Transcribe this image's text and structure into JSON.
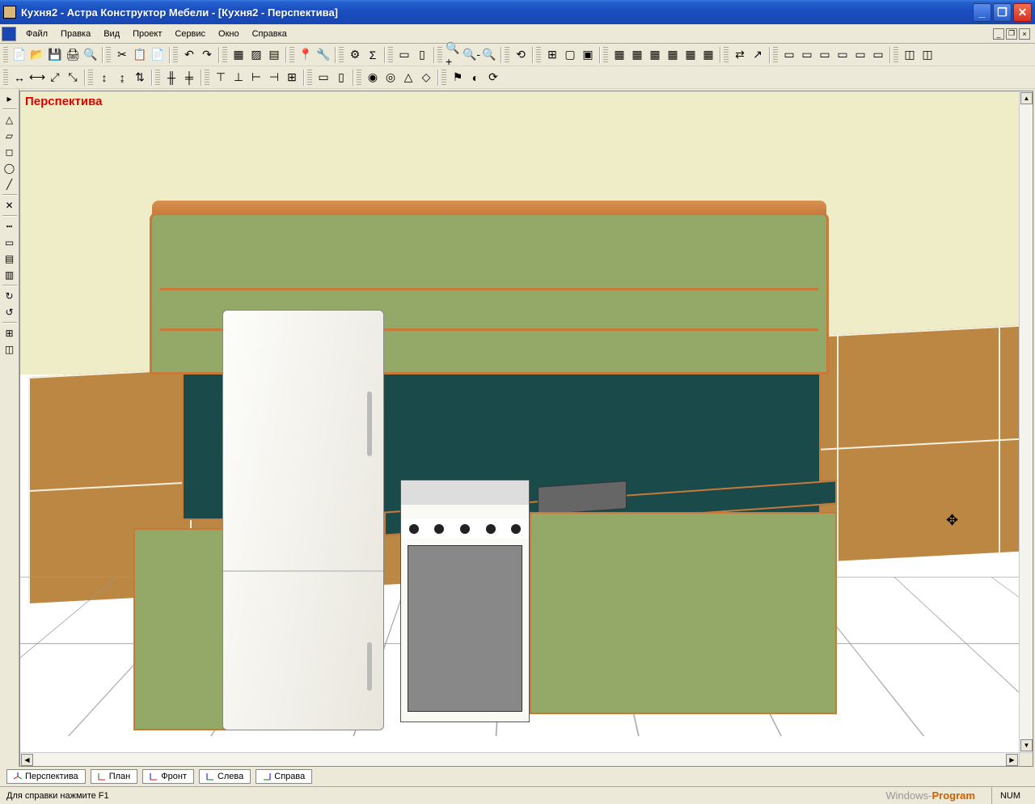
{
  "window": {
    "title": "Кухня2 - Астра Конструктор Мебели - [Кухня2 - Перспектива]"
  },
  "menu": {
    "items": [
      "Файл",
      "Правка",
      "Вид",
      "Проект",
      "Сервис",
      "Окно",
      "Справка"
    ]
  },
  "viewport": {
    "label": "Перспектива"
  },
  "viewTabs": [
    {
      "label": "Перспектива",
      "icon": "axes-3d",
      "active": true
    },
    {
      "label": "План",
      "icon": "axes-top"
    },
    {
      "label": "Фронт",
      "icon": "axes-front"
    },
    {
      "label": "Слева",
      "icon": "axes-left"
    },
    {
      "label": "Справа",
      "icon": "axes-right"
    }
  ],
  "statusbar": {
    "help": "Для справки нажмите F1",
    "watermark_a": "Windows-",
    "watermark_b": "Program",
    "indicator": "NUM"
  },
  "toolbars": {
    "row1_groups": [
      [
        "📄",
        "📂",
        "💾",
        "🖨",
        "🔍"
      ],
      [
        "✂",
        "📋",
        "📄"
      ],
      [
        "↶",
        "↷"
      ],
      [
        "▦",
        "▨",
        "▤"
      ],
      [
        "📍",
        "🔧"
      ],
      [
        "⚙",
        "Σ"
      ],
      [
        "▭",
        "▯"
      ],
      [
        "🔍+",
        "🔍-",
        "🔍"
      ],
      [
        "⟲"
      ],
      [
        "⊞",
        "▢",
        "▣"
      ],
      [
        "▦",
        "▦",
        "▦",
        "▦",
        "▦",
        "▦"
      ],
      [
        "⇄",
        "↗"
      ],
      [
        "▭",
        "▭",
        "▭",
        "▭",
        "▭",
        "▭"
      ],
      [
        "◫",
        "◫"
      ]
    ],
    "row2_groups": [
      [
        "↔",
        "⟷",
        "⤢",
        "⤡"
      ],
      [
        "↕",
        "↨",
        "⇅"
      ],
      [
        "╫",
        "╪"
      ],
      [
        "⊤",
        "⊥",
        "⊢",
        "⊣",
        "⊞"
      ],
      [
        "▭",
        "▯"
      ],
      [
        "◉",
        "◎",
        "△",
        "◇"
      ],
      [
        "⚑",
        "◐",
        "⟳"
      ]
    ],
    "side": [
      "▸",
      "△",
      "▱",
      "◻",
      "◯",
      "╱",
      "✕",
      "┅",
      "▭",
      "▤",
      "▥",
      "↻",
      "↺",
      "⊞",
      "◫"
    ]
  }
}
